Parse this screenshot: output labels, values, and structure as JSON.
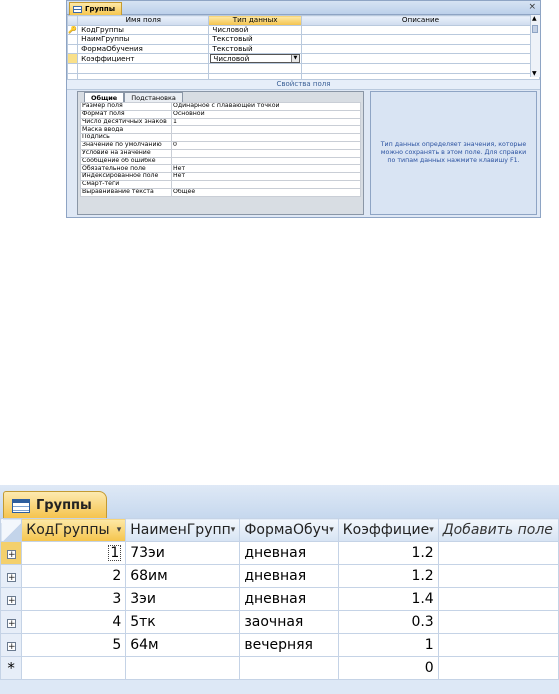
{
  "top": {
    "tab_title": "Группы",
    "close_glyph": "×",
    "columns": [
      "Имя поля",
      "Тип данных",
      "Описание"
    ],
    "rows": [
      {
        "name": "КодГруппы",
        "type": "Числовой",
        "key": true
      },
      {
        "name": "НаимГруппы",
        "type": "Текстовый",
        "key": false
      },
      {
        "name": "ФормаОбучения",
        "type": "Текстовый",
        "key": false
      },
      {
        "name": "Коэффициент",
        "type": "Числовой",
        "key": false,
        "selected": true
      }
    ],
    "props_title": "Свойства поля",
    "props_tabs": [
      "Общие",
      "Подстановка"
    ],
    "props": [
      {
        "name": "Размер поля",
        "value": "Одинарное с плавающей точкой"
      },
      {
        "name": "Формат поля",
        "value": "Основной"
      },
      {
        "name": "Число десятичных знаков",
        "value": "1"
      },
      {
        "name": "Маска ввода",
        "value": ""
      },
      {
        "name": "Подпись",
        "value": ""
      },
      {
        "name": "Значение по умолчанию",
        "value": "0"
      },
      {
        "name": "Условие на значение",
        "value": ""
      },
      {
        "name": "Сообщение об ошибке",
        "value": ""
      },
      {
        "name": "Обязательное поле",
        "value": "Нет"
      },
      {
        "name": "Индексированное поле",
        "value": "Нет"
      },
      {
        "name": "Смарт-теги",
        "value": ""
      },
      {
        "name": "Выравнивание текста",
        "value": "Общее"
      }
    ],
    "help_text": "Тип данных определяет значения, которые можно сохранять в этом поле. Для справки по типам данных нажмите клавишу F1."
  },
  "bottom": {
    "tab_title": "Группы",
    "columns": [
      "КодГруппы",
      "НаименГрупп",
      "ФормаОбуч",
      "Коэффицие",
      "Добавить поле"
    ],
    "sort_glyph": "▾",
    "rows": [
      {
        "id": "1",
        "name": "73эи",
        "form": "дневная",
        "coef": "1.2"
      },
      {
        "id": "2",
        "name": "68им",
        "form": "дневная",
        "coef": "1.2"
      },
      {
        "id": "3",
        "name": "3эи",
        "form": "дневная",
        "coef": "1.4"
      },
      {
        "id": "4",
        "name": "5тк",
        "form": "заочная",
        "coef": "0.3"
      },
      {
        "id": "5",
        "name": "64м",
        "form": "вечерняя",
        "coef": "1"
      }
    ],
    "new_row": {
      "coef": "0"
    },
    "expand_glyph": "+",
    "newrow_glyph": "*"
  }
}
